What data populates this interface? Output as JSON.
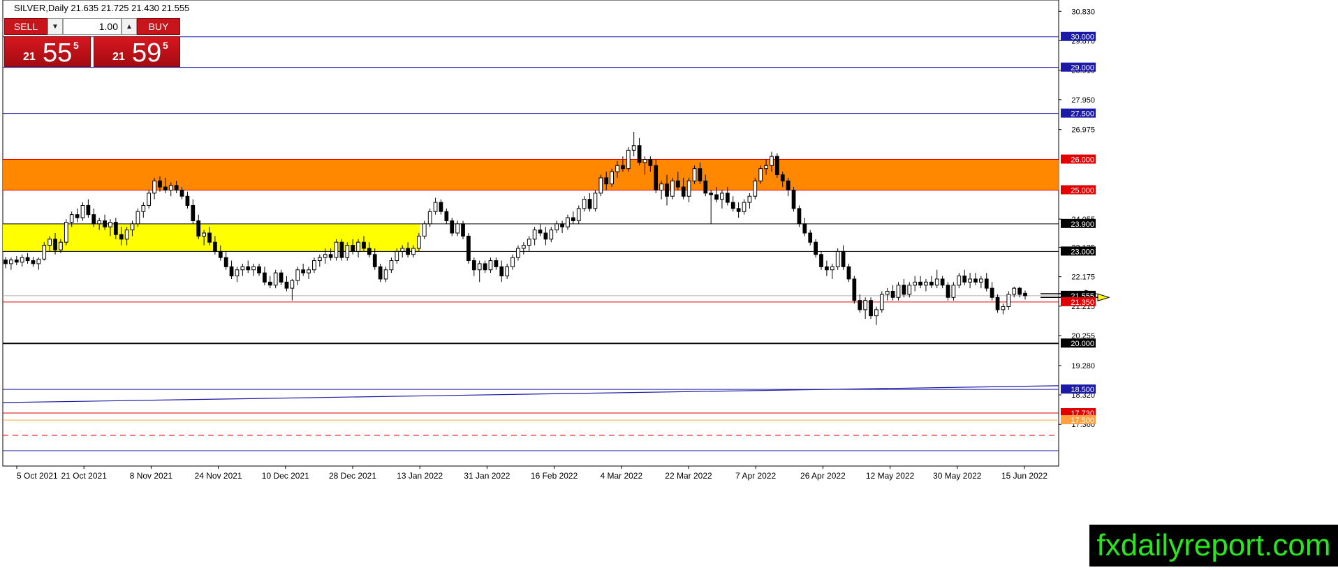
{
  "header": {
    "symbol_text": "SILVER,Daily  21.635 21.725 21.430 21.555"
  },
  "trade_panel": {
    "sell_label": "SELL",
    "buy_label": "BUY",
    "lot_value": "1.00",
    "sell_price": {
      "big_figure": "21",
      "pips": "55",
      "fraction": "5"
    },
    "buy_price": {
      "big_figure": "21",
      "pips": "59",
      "fraction": "5"
    }
  },
  "logo_text": "fxdailyreport.com",
  "colors": {
    "bull_candle": "#ffffff",
    "bear_candle": "#000000",
    "resistance_zone": "#ff8800",
    "support_zone": "#ffff00",
    "blue_line": "#1a1aa6",
    "red_line": "#e00000",
    "black_line": "#000000",
    "green_logo": "#28e81c"
  },
  "chart_data": {
    "type": "candlestick",
    "symbol": "SILVER",
    "timeframe": "Daily",
    "ohlc_readout": {
      "open": 21.635,
      "high": 21.725,
      "low": 21.43,
      "close": 21.555
    },
    "ylim": [
      16.0,
      31.2
    ],
    "y_ticks": [
      "30.830",
      "29.870",
      "28.910",
      "27.950",
      "26.975",
      "24.055",
      "23.135",
      "22.175",
      "21.215",
      "20.255",
      "19.280",
      "18.320",
      "17.360"
    ],
    "x_ticks": [
      "5 Oct 2021",
      "21 Oct 2021",
      "8 Nov 2021",
      "24 Nov 2021",
      "10 Dec 2021",
      "28 Dec 2021",
      "13 Jan 2022",
      "31 Jan 2022",
      "16 Feb 2022",
      "4 Mar 2022",
      "22 Mar 2022",
      "7 Apr 2022",
      "26 Apr 2022",
      "12 May 2022",
      "30 May 2022",
      "15 Jun 2022"
    ],
    "zones": [
      {
        "name": "resistance-zone",
        "from": 25.0,
        "to": 26.0,
        "color": "#ff8800",
        "x_start": "5 Oct 2021",
        "x_end": "right-edge"
      },
      {
        "name": "support-zone",
        "from": 23.0,
        "to": 23.9,
        "color": "#ffff00",
        "x_start": "5 Oct 2021",
        "x_end": "13 Jan 2022"
      }
    ],
    "levels": [
      {
        "value": 30.0,
        "label": "30.000",
        "color": "#1a1aa6",
        "style": "solid"
      },
      {
        "value": 29.0,
        "label": "29.000",
        "color": "#1a1aa6",
        "style": "solid"
      },
      {
        "value": 27.5,
        "label": "27.500",
        "color": "#1a1aa6",
        "style": "solid"
      },
      {
        "value": 26.0,
        "label": "26.000",
        "color": "#e00000",
        "style": "solid"
      },
      {
        "value": 25.0,
        "label": "25.000",
        "color": "#e00000",
        "style": "solid"
      },
      {
        "value": 23.9,
        "label": "23.900",
        "color": "#000000",
        "style": "solid"
      },
      {
        "value": 23.0,
        "label": "23.000",
        "color": "#000000",
        "style": "solid"
      },
      {
        "value": 21.555,
        "label": "21.555",
        "color": "#b0b0b0",
        "style": "solid"
      },
      {
        "value": 21.35,
        "label": "21.350",
        "color": "#e00000",
        "style": "solid"
      },
      {
        "value": 20.0,
        "label": "20.000",
        "color": "#000000",
        "style": "thick"
      },
      {
        "value": 18.5,
        "label": "18.500",
        "color": "#1a1aa6",
        "style": "solid"
      },
      {
        "value": 17.73,
        "label": "17.730",
        "color": "#e00000",
        "style": "solid"
      },
      {
        "value": 17.5,
        "label": "17.500",
        "color": "#ffa040",
        "style": "solid"
      },
      {
        "value": 17.0,
        "label": "",
        "color": "#e00000",
        "style": "dashed"
      },
      {
        "value": 16.5,
        "label": "",
        "color": "#1a1aa6",
        "style": "solid"
      }
    ],
    "trendline": {
      "from_value": 18.07,
      "to_value": 18.62,
      "color": "#1a1aa6"
    },
    "candles": [
      [
        22.72,
        22.82,
        22.45,
        22.6
      ],
      [
        22.6,
        22.8,
        22.4,
        22.72
      ],
      [
        22.72,
        22.85,
        22.55,
        22.65
      ],
      [
        22.65,
        22.9,
        22.5,
        22.8
      ],
      [
        22.8,
        22.95,
        22.6,
        22.7
      ],
      [
        22.7,
        22.82,
        22.5,
        22.6
      ],
      [
        22.6,
        22.8,
        22.4,
        22.75
      ],
      [
        22.75,
        23.3,
        22.7,
        23.2
      ],
      [
        23.2,
        23.5,
        23.0,
        23.4
      ],
      [
        23.4,
        23.6,
        22.9,
        23.05
      ],
      [
        23.05,
        23.4,
        22.95,
        23.3
      ],
      [
        23.3,
        24.05,
        23.2,
        23.95
      ],
      [
        23.95,
        24.3,
        23.8,
        24.2
      ],
      [
        24.2,
        24.4,
        23.95,
        24.1
      ],
      [
        24.1,
        24.6,
        24.0,
        24.5
      ],
      [
        24.5,
        24.7,
        24.1,
        24.2
      ],
      [
        24.2,
        24.4,
        23.8,
        23.9
      ],
      [
        23.9,
        24.1,
        23.7,
        24.0
      ],
      [
        24.0,
        24.2,
        23.7,
        23.8
      ],
      [
        23.8,
        24.05,
        23.5,
        23.95
      ],
      [
        23.95,
        24.1,
        23.4,
        23.55
      ],
      [
        23.55,
        23.8,
        23.2,
        23.4
      ],
      [
        23.4,
        23.8,
        23.2,
        23.7
      ],
      [
        23.7,
        24.0,
        23.5,
        23.9
      ],
      [
        23.9,
        24.4,
        23.8,
        24.3
      ],
      [
        24.3,
        24.6,
        24.1,
        24.5
      ],
      [
        24.5,
        25.0,
        24.4,
        24.9
      ],
      [
        24.9,
        25.4,
        24.7,
        25.3
      ],
      [
        25.3,
        25.45,
        24.95,
        25.1
      ],
      [
        25.1,
        25.4,
        24.9,
        25.0
      ],
      [
        25.0,
        25.25,
        24.8,
        25.15
      ],
      [
        25.15,
        25.3,
        24.9,
        25.0
      ],
      [
        25.0,
        25.1,
        24.7,
        24.8
      ],
      [
        24.8,
        24.95,
        24.4,
        24.5
      ],
      [
        24.5,
        24.7,
        23.9,
        24.0
      ],
      [
        24.0,
        24.2,
        23.4,
        23.5
      ],
      [
        23.5,
        23.7,
        23.2,
        23.6
      ],
      [
        23.6,
        23.8,
        23.2,
        23.3
      ],
      [
        23.3,
        23.5,
        22.9,
        23.0
      ],
      [
        23.0,
        23.2,
        22.7,
        22.8
      ],
      [
        22.8,
        23.0,
        22.4,
        22.5
      ],
      [
        22.5,
        22.7,
        22.1,
        22.2
      ],
      [
        22.2,
        22.5,
        22.0,
        22.4
      ],
      [
        22.4,
        22.6,
        22.2,
        22.5
      ],
      [
        22.5,
        22.7,
        22.3,
        22.4
      ],
      [
        22.4,
        22.6,
        22.2,
        22.5
      ],
      [
        22.5,
        22.6,
        22.2,
        22.3
      ],
      [
        22.3,
        22.5,
        21.9,
        22.0
      ],
      [
        22.0,
        22.2,
        21.8,
        21.9
      ],
      [
        21.9,
        22.4,
        21.8,
        22.3
      ],
      [
        22.3,
        22.4,
        21.9,
        22.0
      ],
      [
        22.0,
        22.2,
        21.7,
        21.8
      ],
      [
        21.8,
        22.1,
        21.4,
        22.05
      ],
      [
        22.05,
        22.5,
        21.9,
        22.4
      ],
      [
        22.4,
        22.6,
        22.2,
        22.3
      ],
      [
        22.3,
        22.5,
        22.1,
        22.4
      ],
      [
        22.4,
        22.8,
        22.3,
        22.7
      ],
      [
        22.7,
        22.9,
        22.5,
        22.8
      ],
      [
        22.8,
        23.1,
        22.6,
        22.9
      ],
      [
        22.9,
        23.1,
        22.7,
        22.8
      ],
      [
        22.8,
        23.4,
        22.7,
        23.3
      ],
      [
        23.3,
        23.4,
        22.7,
        22.8
      ],
      [
        22.8,
        23.3,
        22.7,
        23.2
      ],
      [
        23.2,
        23.4,
        22.9,
        23.0
      ],
      [
        23.0,
        23.4,
        22.8,
        23.3
      ],
      [
        23.3,
        23.5,
        23.0,
        23.1
      ],
      [
        23.1,
        23.3,
        22.8,
        22.9
      ],
      [
        22.9,
        23.1,
        22.4,
        22.5
      ],
      [
        22.5,
        22.6,
        22.0,
        22.1
      ],
      [
        22.1,
        22.5,
        22.0,
        22.4
      ],
      [
        22.4,
        22.8,
        22.3,
        22.7
      ],
      [
        22.7,
        23.1,
        22.6,
        23.0
      ],
      [
        23.0,
        23.2,
        22.8,
        23.1
      ],
      [
        23.1,
        23.3,
        22.8,
        22.9
      ],
      [
        22.9,
        23.2,
        22.8,
        23.1
      ],
      [
        23.1,
        23.6,
        23.0,
        23.5
      ],
      [
        23.5,
        24.0,
        23.4,
        23.9
      ],
      [
        23.9,
        24.4,
        23.8,
        24.3
      ],
      [
        24.3,
        24.75,
        24.2,
        24.6
      ],
      [
        24.6,
        24.7,
        24.2,
        24.3
      ],
      [
        24.3,
        24.4,
        23.9,
        24.0
      ],
      [
        24.0,
        24.1,
        23.5,
        23.6
      ],
      [
        23.6,
        24.0,
        23.5,
        23.9
      ],
      [
        23.9,
        24.0,
        23.4,
        23.5
      ],
      [
        23.5,
        23.6,
        22.6,
        22.7
      ],
      [
        22.7,
        22.8,
        22.2,
        22.4
      ],
      [
        22.4,
        22.7,
        22.0,
        22.6
      ],
      [
        22.6,
        22.7,
        22.3,
        22.4
      ],
      [
        22.4,
        22.8,
        22.3,
        22.7
      ],
      [
        22.7,
        22.8,
        22.4,
        22.5
      ],
      [
        22.5,
        22.7,
        22.0,
        22.2
      ],
      [
        22.2,
        22.6,
        22.1,
        22.5
      ],
      [
        22.5,
        22.9,
        22.4,
        22.8
      ],
      [
        22.8,
        23.2,
        22.7,
        23.1
      ],
      [
        23.1,
        23.3,
        22.9,
        23.2
      ],
      [
        23.2,
        23.5,
        23.0,
        23.4
      ],
      [
        23.4,
        23.8,
        23.2,
        23.7
      ],
      [
        23.7,
        23.9,
        23.5,
        23.6
      ],
      [
        23.6,
        23.8,
        23.2,
        23.4
      ],
      [
        23.4,
        23.8,
        23.3,
        23.7
      ],
      [
        23.7,
        24.0,
        23.6,
        23.9
      ],
      [
        23.9,
        24.0,
        23.6,
        23.8
      ],
      [
        23.8,
        24.2,
        23.7,
        24.1
      ],
      [
        24.1,
        24.3,
        23.9,
        24.0
      ],
      [
        24.0,
        24.5,
        23.9,
        24.4
      ],
      [
        24.4,
        24.8,
        24.3,
        24.7
      ],
      [
        24.7,
        24.9,
        24.3,
        24.4
      ],
      [
        24.4,
        25.0,
        24.3,
        24.9
      ],
      [
        24.9,
        25.5,
        24.8,
        25.4
      ],
      [
        25.4,
        25.6,
        25.0,
        25.2
      ],
      [
        25.2,
        25.7,
        25.1,
        25.6
      ],
      [
        25.6,
        25.95,
        25.4,
        25.8
      ],
      [
        25.8,
        26.1,
        25.6,
        25.7
      ],
      [
        25.7,
        26.4,
        25.6,
        26.3
      ],
      [
        26.3,
        26.9,
        26.1,
        26.45
      ],
      [
        26.45,
        26.7,
        25.8,
        25.9
      ],
      [
        25.9,
        26.1,
        25.5,
        26.0
      ],
      [
        26.0,
        26.1,
        25.6,
        25.8
      ],
      [
        25.8,
        26.0,
        24.9,
        25.0
      ],
      [
        25.0,
        25.3,
        24.7,
        25.2
      ],
      [
        25.2,
        25.5,
        24.5,
        24.8
      ],
      [
        24.8,
        25.4,
        24.7,
        25.3
      ],
      [
        25.3,
        25.6,
        25.0,
        25.1
      ],
      [
        25.1,
        25.4,
        24.7,
        24.8
      ],
      [
        24.8,
        25.4,
        24.6,
        25.3
      ],
      [
        25.3,
        25.8,
        25.2,
        25.7
      ],
      [
        25.7,
        25.9,
        25.2,
        25.3
      ],
      [
        25.3,
        25.5,
        24.8,
        24.9
      ],
      [
        24.9,
        25.0,
        23.9,
        24.85
      ],
      [
        24.85,
        25.1,
        24.6,
        24.7
      ],
      [
        24.7,
        25.0,
        24.4,
        24.9
      ],
      [
        24.9,
        25.1,
        24.5,
        24.6
      ],
      [
        24.6,
        24.8,
        24.3,
        24.4
      ],
      [
        24.4,
        24.6,
        24.1,
        24.3
      ],
      [
        24.3,
        24.7,
        24.2,
        24.6
      ],
      [
        24.6,
        24.9,
        24.4,
        24.8
      ],
      [
        24.8,
        25.4,
        24.7,
        25.3
      ],
      [
        25.3,
        25.8,
        25.2,
        25.7
      ],
      [
        25.7,
        26.0,
        25.5,
        25.8
      ],
      [
        25.8,
        26.25,
        25.6,
        26.1
      ],
      [
        26.1,
        26.2,
        25.4,
        25.5
      ],
      [
        25.5,
        25.6,
        25.1,
        25.3
      ],
      [
        25.3,
        25.4,
        24.8,
        25.0
      ],
      [
        25.0,
        25.1,
        24.3,
        24.4
      ],
      [
        24.4,
        24.5,
        23.8,
        23.9
      ],
      [
        23.9,
        24.1,
        23.5,
        23.6
      ],
      [
        23.6,
        23.7,
        23.2,
        23.3
      ],
      [
        23.3,
        23.4,
        22.8,
        22.9
      ],
      [
        22.9,
        23.0,
        22.4,
        22.5
      ],
      [
        22.5,
        22.7,
        22.2,
        22.4
      ],
      [
        22.4,
        22.6,
        22.1,
        22.5
      ],
      [
        22.5,
        23.1,
        22.4,
        23.0
      ],
      [
        23.0,
        23.2,
        22.4,
        22.5
      ],
      [
        22.5,
        22.6,
        22.0,
        22.1
      ],
      [
        22.1,
        22.2,
        21.3,
        21.4
      ],
      [
        21.4,
        21.6,
        21.0,
        21.1
      ],
      [
        21.1,
        21.5,
        20.8,
        21.4
      ],
      [
        21.4,
        21.5,
        20.8,
        20.9
      ],
      [
        20.9,
        21.2,
        20.6,
        21.1
      ],
      [
        21.1,
        21.7,
        21.0,
        21.6
      ],
      [
        21.6,
        21.8,
        21.4,
        21.7
      ],
      [
        21.7,
        21.9,
        21.4,
        21.5
      ],
      [
        21.5,
        22.0,
        21.4,
        21.9
      ],
      [
        21.9,
        22.1,
        21.5,
        21.6
      ],
      [
        21.6,
        22.0,
        21.5,
        21.9
      ],
      [
        21.9,
        22.2,
        21.7,
        22.0
      ],
      [
        22.0,
        22.2,
        21.8,
        21.9
      ],
      [
        21.9,
        22.1,
        21.7,
        22.0
      ],
      [
        22.0,
        22.2,
        21.8,
        21.9
      ],
      [
        21.9,
        22.4,
        21.8,
        22.1
      ],
      [
        22.1,
        22.2,
        21.8,
        21.9
      ],
      [
        21.9,
        22.0,
        21.4,
        21.5
      ],
      [
        21.5,
        22.0,
        21.4,
        21.9
      ],
      [
        21.9,
        22.3,
        21.8,
        22.2
      ],
      [
        22.2,
        22.4,
        21.9,
        22.0
      ],
      [
        22.0,
        22.3,
        21.8,
        22.1
      ],
      [
        22.1,
        22.3,
        21.9,
        22.0
      ],
      [
        22.0,
        22.2,
        21.8,
        22.1
      ],
      [
        22.1,
        22.3,
        21.7,
        21.8
      ],
      [
        21.8,
        22.0,
        21.4,
        21.5
      ],
      [
        21.5,
        21.6,
        21.0,
        21.1
      ],
      [
        21.1,
        21.3,
        20.95,
        21.2
      ],
      [
        21.2,
        21.7,
        21.1,
        21.6
      ],
      [
        21.6,
        21.85,
        21.5,
        21.8
      ],
      [
        21.8,
        21.85,
        21.5,
        21.6
      ],
      [
        21.635,
        21.725,
        21.43,
        21.555
      ]
    ],
    "annotation_arrows": [
      {
        "direction": "right",
        "y_values": [
          21.62,
          21.5
        ],
        "color": "#ffff00"
      }
    ],
    "grid": false,
    "legend": "none"
  }
}
